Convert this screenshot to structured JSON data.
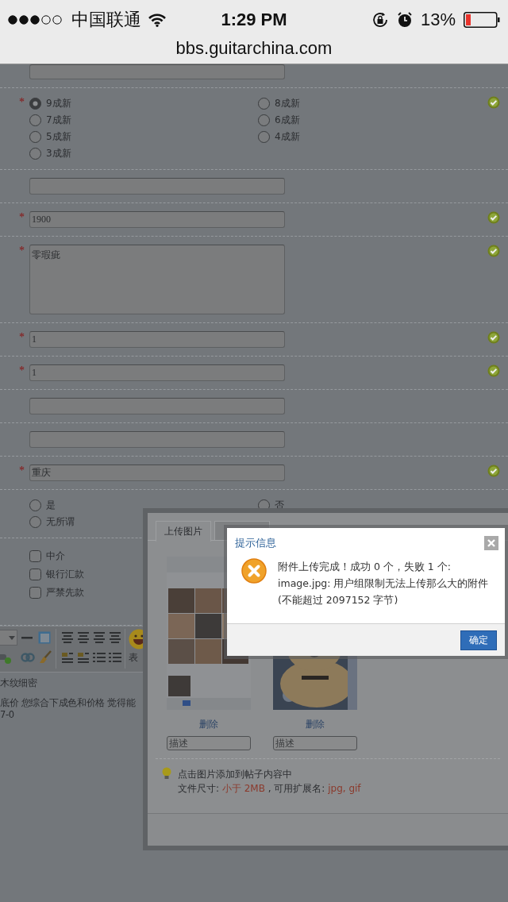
{
  "status_bar": {
    "carrier": "中国联通",
    "time": "1:29 PM",
    "battery": "13%"
  },
  "address_bar": {
    "url": "bbs.guitarchina.com"
  },
  "form": {
    "rows": [
      {
        "kind": "field",
        "valid": false
      },
      {
        "kind": "radio",
        "required_mark": "*",
        "valid": true,
        "options": [
          {
            "label": "9成新",
            "selected": true
          },
          {
            "label": "8成新",
            "selected": false
          },
          {
            "label": "7成新",
            "selected": false
          },
          {
            "label": "6成新",
            "selected": false
          },
          {
            "label": "5成新",
            "selected": false
          },
          {
            "label": "4成新",
            "selected": false
          },
          {
            "label": "3成新",
            "selected": false
          }
        ]
      },
      {
        "kind": "field",
        "valid": false
      },
      {
        "kind": "field",
        "required_mark": "*",
        "valid": true,
        "value": "1900"
      },
      {
        "kind": "textarea",
        "required_mark": "*",
        "valid": true,
        "value": "零瑕疵"
      },
      {
        "kind": "field",
        "required_mark": "*",
        "valid": true,
        "value": "1"
      },
      {
        "kind": "field",
        "required_mark": "*",
        "valid": true,
        "value": "1"
      },
      {
        "kind": "field",
        "valid": false
      },
      {
        "kind": "field",
        "valid": false
      },
      {
        "kind": "field",
        "required_mark": "*",
        "valid": true,
        "value": "重庆"
      },
      {
        "kind": "radio",
        "valid": false,
        "options": [
          {
            "label": "是",
            "selected": false
          },
          {
            "label": "否",
            "selected": false
          },
          {
            "label": "无所谓",
            "selected": false
          }
        ]
      },
      {
        "kind": "checklist",
        "valid": false,
        "options": [
          {
            "label": "中介",
            "checked": false
          },
          {
            "label": "银行汇款",
            "checked": false
          },
          {
            "label": "严禁先款",
            "checked": false
          }
        ]
      }
    ]
  },
  "editor": {
    "emoji_label": "表",
    "content": [
      "木纹细密",
      "底价 您综合下成色和价格 觉得能",
      "7-0"
    ]
  },
  "upload_panel": {
    "tabs": [
      {
        "label": "上传图片",
        "selected": true
      },
      {
        "selected": false
      }
    ],
    "images": [
      {
        "kind": "picture",
        "delete_label": "删除",
        "description_placeholder": "描述"
      },
      {
        "kind": "picture",
        "delete_label": "删除",
        "description_placeholder": "描述"
      }
    ],
    "tip": "点击图片添加到帖子内容中",
    "file_info": [
      {
        "text": "文件尺寸: ",
        "highlight": false
      },
      {
        "text": "小于 2MB",
        "highlight": true
      },
      {
        "text": " , 可用扩展名: ",
        "highlight": false
      },
      {
        "text": "jpg, gif",
        "highlight": true
      }
    ]
  },
  "dialog": {
    "title": "提示信息",
    "message": "附件上传完成！成功 0 个，失败 1 个: image.jpg: 用户组限制无法上传那么大的附件(不能超过 2097152 字节)",
    "confirm": "确定"
  }
}
